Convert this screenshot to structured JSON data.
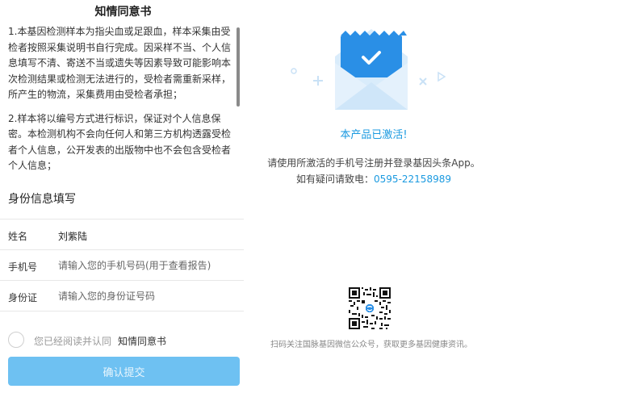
{
  "consent": {
    "title": "知情同意书",
    "paragraphs": [
      "1.本基因检测样本为指尖血或足跟血，样本采集由受检者按照采集说明书自行完成。因采样不当、个人信息填写不清、寄送不当或遗失等因素导致可能影响本次检测结果或检测无法进行的，受检者需重新采样，所产生的物流，采集费用由受检者承担；",
      "2.样本将以编号方式进行标识，保证对个人信息保密。本检测机构不会向任何人和第三方机构透露受检者个人信息，公开发表的出版物中也不会包含受检者个人信息；"
    ]
  },
  "form": {
    "section_title": "身份信息填写",
    "name_label": "姓名",
    "name_value": "刘紫陆",
    "phone_label": "手机号",
    "phone_placeholder": "请输入您的手机号码(用于查看报告)",
    "id_label": "身份证",
    "id_placeholder": "请输入您的身份证号码",
    "agree_text": "您已经阅读并认同",
    "agree_link": "知情同意书",
    "submit_label": "确认提交"
  },
  "status": {
    "activated": "本产品已激活!",
    "instruction": "请使用所激活的手机号注册并登录基因头条App。",
    "contact_prefix": "如有疑问请致电：",
    "contact_phone": "0595-22158989",
    "qr_caption": "扫码关注国脉基因微信公众号，获取更多基因健康资讯。"
  },
  "colors": {
    "accent": "#1b9ae0",
    "button_bg": "#6ec1f2",
    "envelope_blue": "#2a8fe6"
  },
  "icons": {
    "envelope": "envelope-check-icon",
    "qr": "qr-code-icon"
  }
}
